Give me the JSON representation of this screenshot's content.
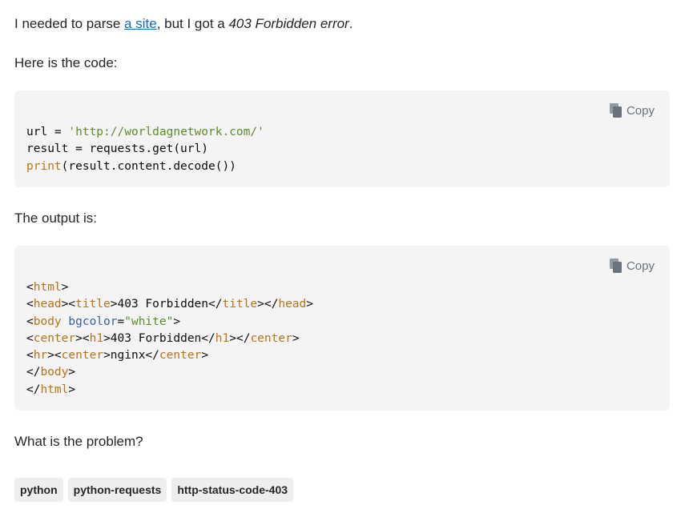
{
  "intro": {
    "before_link": "I needed to parse ",
    "link_text": "a site",
    "after_link": ", but I got a ",
    "error_text": "403 Forbidden error",
    "end": "."
  },
  "code_intro": "Here is the code:",
  "code_block_1": {
    "copy_label": "Copy",
    "lines": {
      "l1_var": "url = ",
      "l1_str": "'http://worldagnetwork.com/'",
      "l2": "result = requests.get(url)",
      "l3_kw": "print",
      "l3_rest": "(result.content.decode())"
    }
  },
  "output_intro": "The output is:",
  "code_block_2": {
    "copy_label": "Copy",
    "tags": {
      "html": "html",
      "head": "head",
      "title": "title",
      "title_text": "403 Forbidden",
      "body": "body",
      "bgcolor_attr": "bgcolor",
      "bgcolor_val": "\"white\"",
      "center": "center",
      "h1": "h1",
      "h1_text": "403 Forbidden",
      "hr": "hr",
      "nginx_text": "nginx"
    }
  },
  "question": "What is the problem?",
  "tags_list": [
    "python",
    "python-requests",
    "http-status-code-403"
  ],
  "colors": {
    "link": "#0c6bc4",
    "code_bg": "#f4f4f4",
    "string": "#5d8c2c",
    "keyword": "#b8731b",
    "attribute": "#3464a4",
    "tag_bg": "#eeeeee"
  }
}
